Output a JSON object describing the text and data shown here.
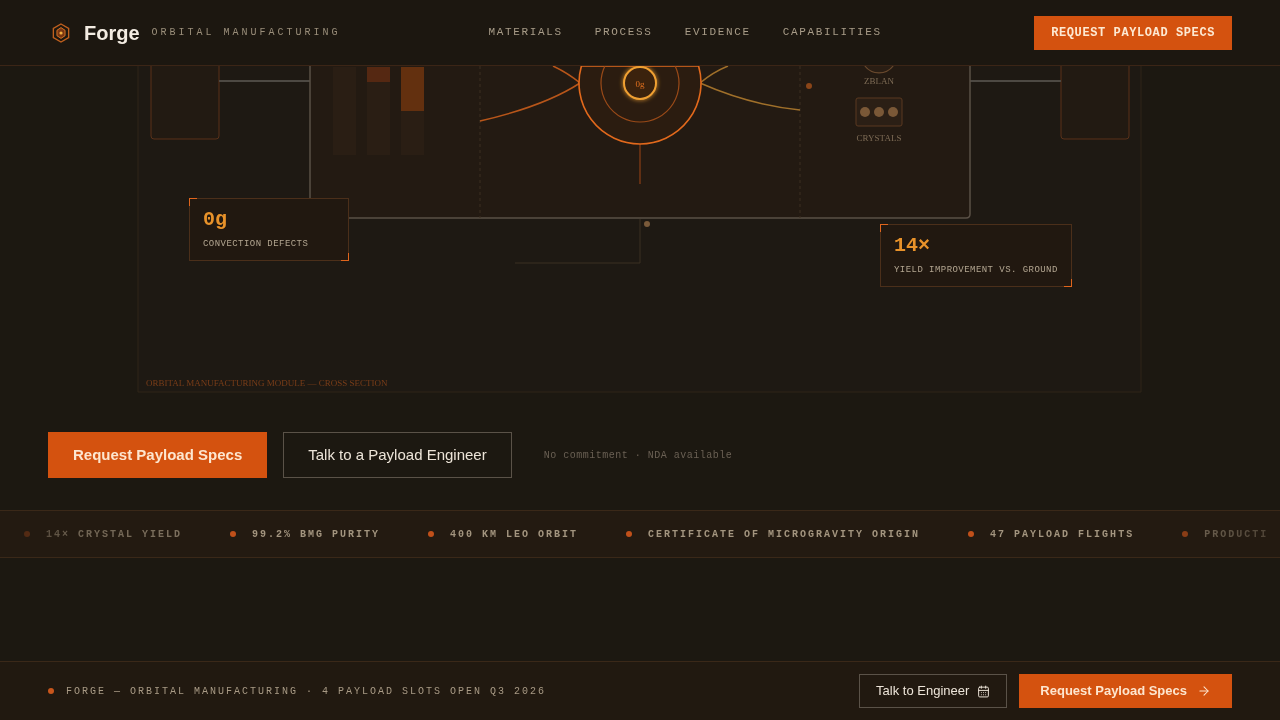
{
  "header": {
    "brand": "Forge",
    "tagline": "ORBITAL MANUFACTURING",
    "nav": [
      {
        "label": "MATERIALS"
      },
      {
        "label": "PROCESS"
      },
      {
        "label": "EVIDENCE"
      },
      {
        "label": "CAPABILITIES"
      }
    ],
    "cta": "REQUEST PAYLOAD SPECS"
  },
  "diagram": {
    "chamber_label": "0g",
    "component_labels": [
      "ZBLAN",
      "CRYSTALS"
    ],
    "caption": "ORBITAL MANUFACTURING MODULE — CROSS SECTION",
    "callouts": [
      {
        "value": "0g",
        "label": "CONVECTION DEFECTS"
      },
      {
        "value": "14×",
        "label": "YIELD IMPROVEMENT VS. GROUND"
      }
    ]
  },
  "actions": {
    "buttons": [
      {
        "kind": "primary",
        "label": "Request Payload Specs"
      },
      {
        "kind": "secondary",
        "label": "Talk to a Payload Engineer"
      }
    ],
    "note": "No commitment · NDA available"
  },
  "ticker": [
    "14× CRYSTAL YIELD",
    "99.2% BMG PURITY",
    "400 KM LEO ORBIT",
    "CERTIFICATE OF MICROGRAVITY ORIGIN",
    "47 PAYLOAD FLIGHTS",
    "PRODUCTI"
  ],
  "footer": {
    "status": "FORGE — ORBITAL MANUFACTURING · 4 PAYLOAD SLOTS OPEN Q3 2026",
    "buttons": [
      {
        "kind": "secondary",
        "label": "Talk to Engineer"
      },
      {
        "kind": "primary",
        "label": "Request Payload Specs"
      }
    ]
  }
}
